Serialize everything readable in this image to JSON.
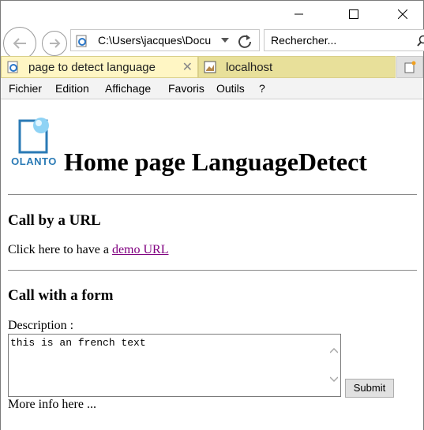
{
  "address_bar": {
    "url": "C:\\Users\\jacques\\Docu"
  },
  "search_bar": {
    "placeholder": "Rechercher..."
  },
  "tabs": [
    {
      "label": "page to detect language",
      "active": true
    },
    {
      "label": "localhost",
      "active": false
    }
  ],
  "menu": [
    "Fichier",
    "Edition",
    "Affichage",
    "Favoris",
    "Outils",
    "?"
  ],
  "page": {
    "logo_text": "OLANTO",
    "title": "Home page LanguageDetect",
    "section1_title": "Call by a URL",
    "section1_text": "Click here to have a ",
    "section1_link": "demo URL",
    "section2_title": "Call with a form",
    "description_label": "Description :",
    "textarea_value": "this is an french text",
    "submit_label": "Submit",
    "footer_text": "More info here ..."
  },
  "colors": {
    "link": "#800080",
    "tab_active": "#fff6c4",
    "tab_inactive": "#e8e09a",
    "logo": "#2a7ab5"
  }
}
